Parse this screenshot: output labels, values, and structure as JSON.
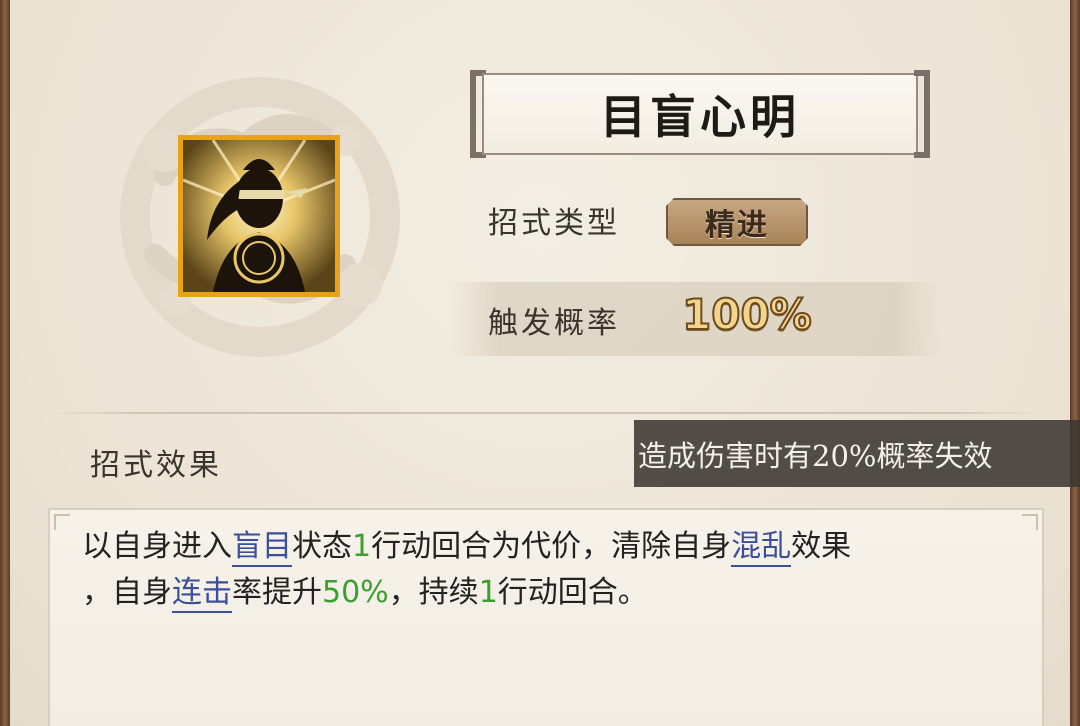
{
  "skill": {
    "name": "目盲心明",
    "icon": "blindfolded-swordsman-icon"
  },
  "stats": {
    "type_label": "招式类型",
    "type_value": "精进",
    "chance_label": "触发概率",
    "chance_value": "100%"
  },
  "effect": {
    "heading": "招式效果",
    "tooltip": "造成伤害时有20%概率失效",
    "line1": {
      "t1": "以自身进入",
      "kw1": "盲目",
      "t2": "状态",
      "n1": "1",
      "t3": "行动回合为代价，清除自身",
      "kw2": "混乱",
      "t4": "效果"
    },
    "line2": {
      "t1": "，自身",
      "kw1": "连击",
      "t2": "率提升",
      "n1": "50%",
      "t3": "，持续",
      "n2": "1",
      "t4": "行动回合。"
    }
  },
  "colors": {
    "icon_frame": "#e8a317",
    "keyword": "#3c4f9a",
    "number": "#3aa02c",
    "percent_fill": "#f4d48a"
  }
}
